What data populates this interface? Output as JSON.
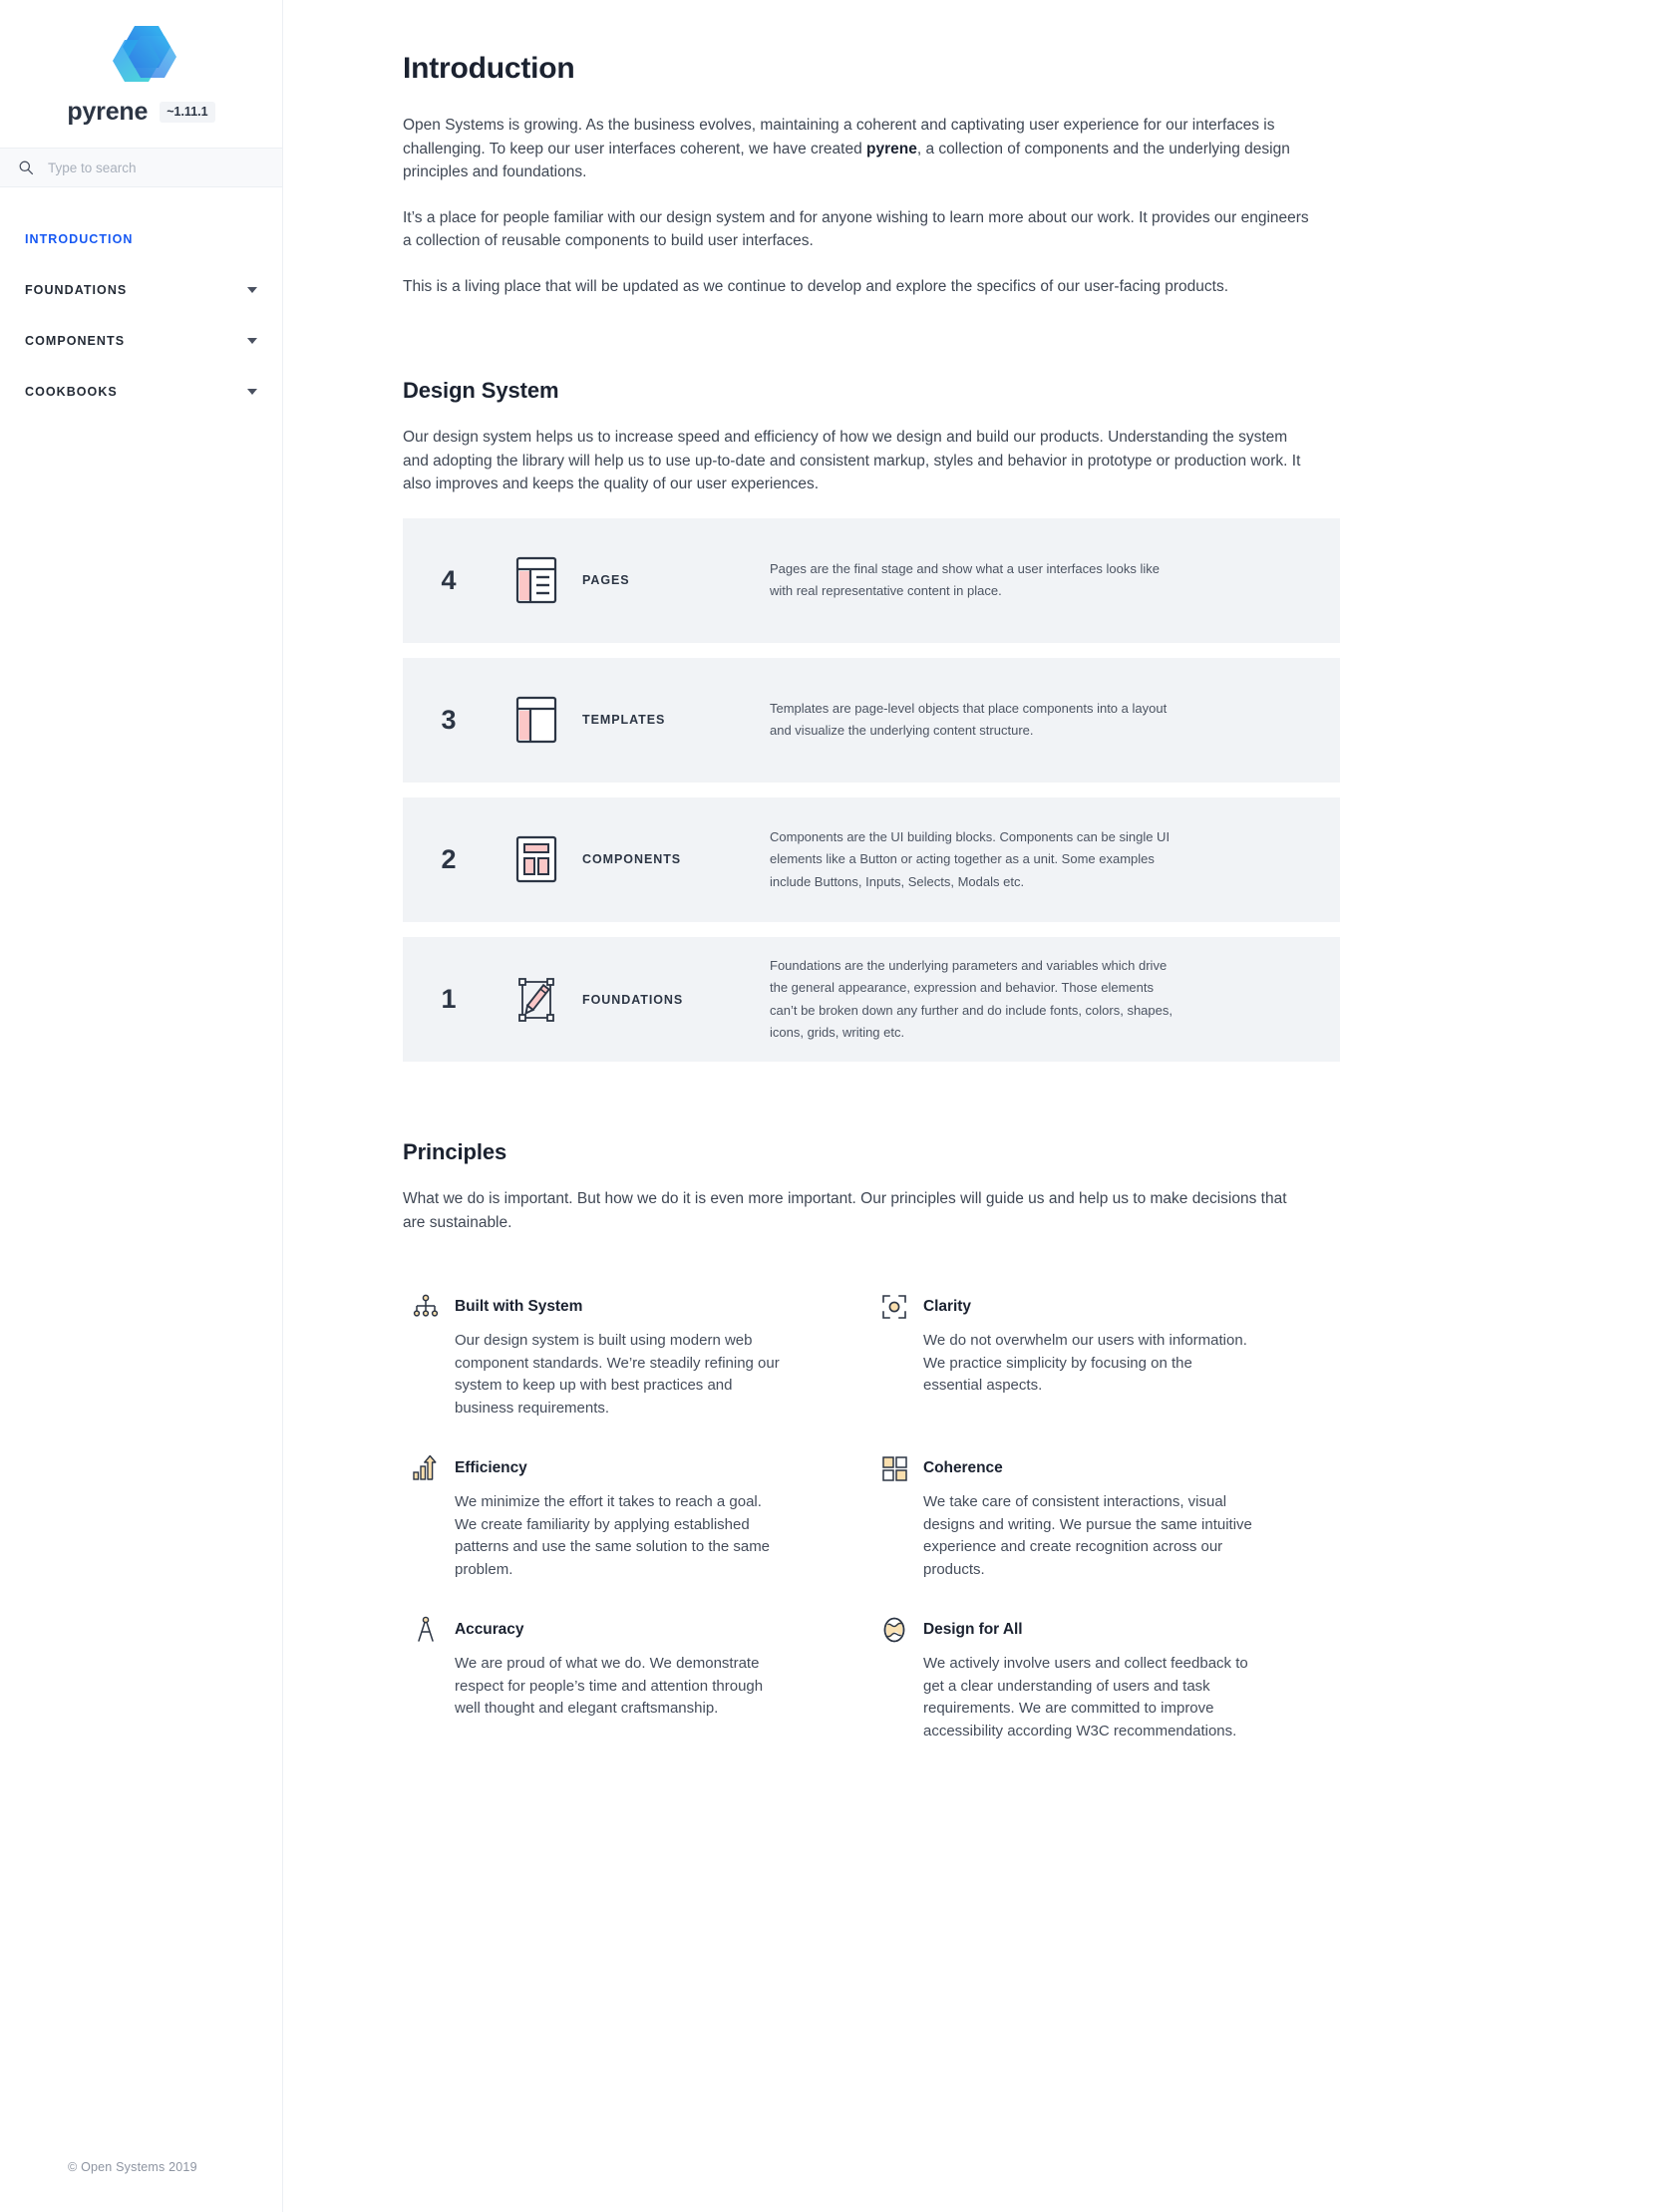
{
  "brand": {
    "name": "pyrene",
    "version": "~1.11.1",
    "logo_icon": "pyrene-hexagon-logo"
  },
  "search": {
    "placeholder": "Type to search",
    "value": "",
    "icon": "search-icon"
  },
  "sidebar": {
    "items": [
      {
        "label": "INTRODUCTION",
        "active": true,
        "expandable": false
      },
      {
        "label": "FOUNDATIONS",
        "active": false,
        "expandable": true
      },
      {
        "label": "COMPONENTS",
        "active": false,
        "expandable": true
      },
      {
        "label": "COOKBOOKS",
        "active": false,
        "expandable": true
      }
    ],
    "caret_icon": "chevron-down-icon",
    "active_color": "#1658f3"
  },
  "intro": {
    "title": "Introduction",
    "p1_before": "Open Systems is growing. As the business evolves, maintaining a coherent and captivating user experience for our interfaces is challenging. To keep our user interfaces coherent, we have created ",
    "p1_bold": "pyrene",
    "p1_after": ", a collection of components and the underlying design principles and foundations.",
    "p2": "It’s a place for people familiar with our design system and for anyone wishing to learn more about our work. It provides our engineers a collection of reusable components to build user interfaces.",
    "p3": "This is a living place that will be updated as we continue to develop and explore the specifics of our user-facing products."
  },
  "design_system": {
    "title": "Design System",
    "intro": "Our design system helps us to increase speed and efficiency of how we design and build our products. Understanding the system and adopting the library will help us to use up-to-date and consistent markup, styles and behavior in prototype or production work. It also improves and keeps the quality of our user experiences.",
    "cards": [
      {
        "number": "4",
        "label": "PAGES",
        "icon": "pages-icon",
        "description": "Pages are the final stage and show what a user interfaces looks like with real representative content in place."
      },
      {
        "number": "3",
        "label": "TEMPLATES",
        "icon": "templates-icon",
        "description": "Templates are page-level objects that place components into a layout and visualize the underlying content structure."
      },
      {
        "number": "2",
        "label": "COMPONENTS",
        "icon": "components-icon",
        "description": "Components are the UI building blocks. Components can be single UI elements like a Button or acting together as a unit. Some examples include Buttons, Inputs, Selects, Modals etc."
      },
      {
        "number": "1",
        "label": "FOUNDATIONS",
        "icon": "foundations-icon",
        "description": "Foundations are the underlying parameters and variables which drive the general appearance, expression and behavior. Those elements can’t be broken down any further and do include fonts, colors, shapes, icons, grids, writing etc."
      }
    ],
    "card_bg": "#f1f3f6",
    "icon_accent": "#fbc7c7",
    "icon_stroke": "#2c3544"
  },
  "principles": {
    "title": "Principles",
    "intro": "What we do is important. But how we do it is even more important. Our principles will guide us and help us to make decisions that are sustainable.",
    "accent": "#fadfae",
    "items": [
      {
        "title": "Built with System",
        "icon": "hierarchy-icon",
        "text": "Our design system is built using modern web component standards. We’re steadily refining our system to keep up with best practices and business requirements."
      },
      {
        "title": "Clarity",
        "icon": "focus-target-icon",
        "text": "We do not overwhelm our users with information. We practice simplicity by focusing on the essential aspects."
      },
      {
        "title": "Efficiency",
        "icon": "bar-chart-arrow-icon",
        "text": "We minimize the effort it takes to reach a goal. We create familiarity by applying established patterns and use the same solution to the same problem."
      },
      {
        "title": "Coherence",
        "icon": "grid-squares-icon",
        "text": "We take care of consistent interactions, visual designs and writing. We pursue the same intuitive experience and create recognition across our products."
      },
      {
        "title": "Accuracy",
        "icon": "compass-divider-icon",
        "text": "We are proud of what we do. We demonstrate respect for people’s time and attention through well thought and elegant craftsmanship."
      },
      {
        "title": "Design for All",
        "icon": "globe-icon",
        "text": "We actively involve users and collect feedback to get a clear understanding of users and task requirements. We are committed to improve accessibility according W3C recommendations."
      }
    ]
  },
  "footer": {
    "copyright": "© Open Systems 2019"
  }
}
